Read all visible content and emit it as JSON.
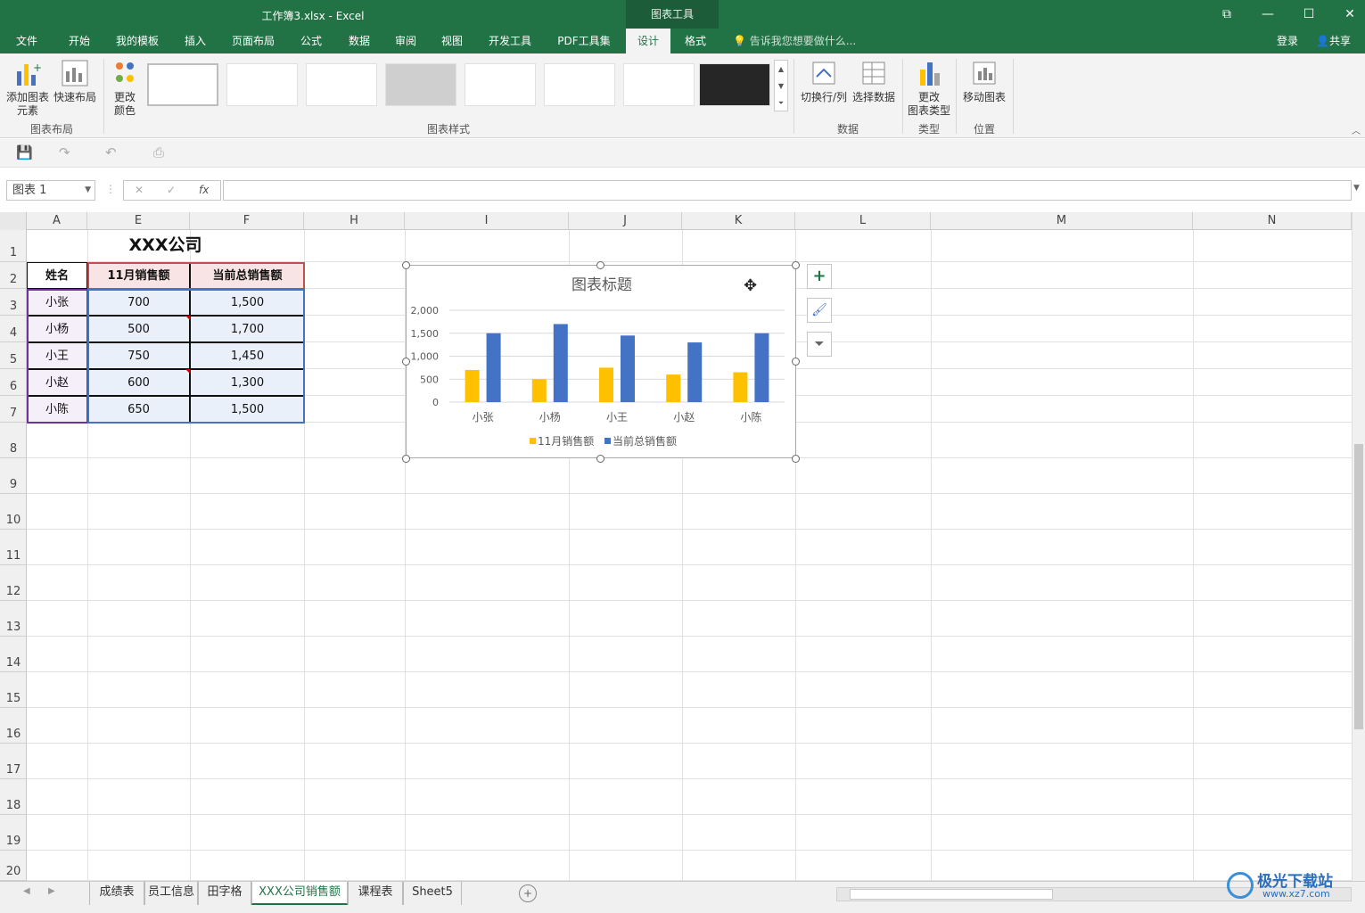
{
  "window": {
    "title": "工作簿3.xlsx - Excel",
    "context_tab": "图表工具",
    "controls": [
      "restore-ribbon",
      "minimize",
      "maximize",
      "close"
    ]
  },
  "ribbon_tabs": [
    "文件",
    "开始",
    "我的模板",
    "插入",
    "页面布局",
    "公式",
    "数据",
    "审阅",
    "视图",
    "开发工具",
    "PDF工具集",
    "设计",
    "格式"
  ],
  "active_tab": "设计",
  "tell_me": "告诉我您想要做什么...",
  "login": "登录",
  "share": "共享",
  "ribbon": {
    "add_element_line1": "添加图表",
    "add_element_line2": "元素",
    "quick_layout": "快速布局",
    "change_colors_line1": "更改",
    "change_colors_line2": "颜色",
    "group_layout": "图表布局",
    "group_styles": "图表样式",
    "switch_row_col": "切换行/列",
    "select_data": "选择数据",
    "group_data": "数据",
    "change_type_line1": "更改",
    "change_type_line2": "图表类型",
    "group_type": "类型",
    "move_chart": "移动图表",
    "group_location": "位置"
  },
  "namebox": "图表 1",
  "fx": "fx",
  "columns": [
    "A",
    "E",
    "F",
    "H",
    "I",
    "J",
    "K",
    "L",
    "M",
    "N"
  ],
  "rows": [
    "1",
    "2",
    "3",
    "4",
    "5",
    "6",
    "7",
    "8",
    "9",
    "10",
    "11",
    "12",
    "13",
    "14",
    "15",
    "16",
    "17",
    "18",
    "19",
    "20"
  ],
  "table": {
    "company": "XXX公司",
    "headers": [
      "姓名",
      "11月销售额",
      "当前总销售额"
    ],
    "rows": [
      [
        "小张",
        "700",
        "1,500"
      ],
      [
        "小杨",
        "500",
        "1,700"
      ],
      [
        "小王",
        "750",
        "1,450"
      ],
      [
        "小赵",
        "600",
        "1,300"
      ],
      [
        "小陈",
        "650",
        "1,500"
      ]
    ]
  },
  "chart_data": {
    "type": "bar",
    "title": "图表标题",
    "categories": [
      "小张",
      "小杨",
      "小王",
      "小赵",
      "小陈"
    ],
    "series": [
      {
        "name": "11月销售额",
        "values": [
          700,
          500,
          750,
          600,
          650
        ],
        "color": "#ffc000"
      },
      {
        "name": "当前总销售额",
        "values": [
          1500,
          1700,
          1450,
          1300,
          1500
        ],
        "color": "#4472c4"
      }
    ],
    "yticks": [
      "0",
      "500",
      "1,000",
      "1,500",
      "2,000"
    ],
    "ylim": [
      0,
      2000
    ],
    "grid": true,
    "legend": "bottom"
  },
  "sheets": [
    "成绩表",
    "员工信息",
    "田字格",
    "XXX公司销售额",
    "课程表",
    "Sheet5"
  ],
  "active_sheet": "XXX公司销售额",
  "watermark": {
    "text1": "极光下载站",
    "text2": "www.xz7.com"
  },
  "colors": {
    "excel_green": "#217346",
    "grid": "#e1e1e1"
  }
}
